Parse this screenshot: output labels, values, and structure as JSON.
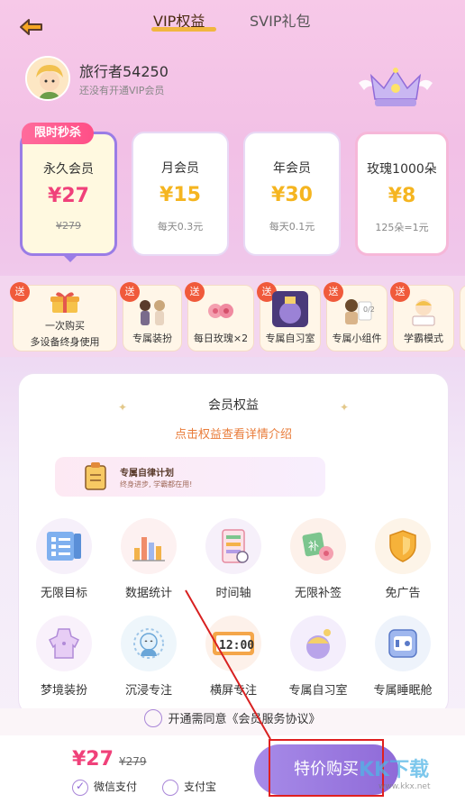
{
  "tabs": [
    {
      "label": "VIP权益"
    },
    {
      "label": "SVIP礼包"
    }
  ],
  "user": {
    "name": "旅行者54250",
    "status": "还没有开通VIP会员"
  },
  "badge": "限时秒杀",
  "plans": [
    {
      "name": "永久会员",
      "price": "¥27",
      "sub": "¥279"
    },
    {
      "name": "月会员",
      "price": "¥15",
      "sub": "每天0.3元"
    },
    {
      "name": "年会员",
      "price": "¥30",
      "sub": "每天0.1元"
    },
    {
      "name": "玫瑰1000朵",
      "price": "¥8",
      "sub": "125朵=1元"
    }
  ],
  "perks": {
    "send": "送",
    "items": [
      {
        "label": "一次购买\n多设备终身使用",
        "label1": "一次购买",
        "label2": "多设备终身使用"
      },
      {
        "label": "专属装扮"
      },
      {
        "label": "每日玫瑰×2"
      },
      {
        "label": "专属自习室"
      },
      {
        "label": "专属小组件",
        "counter": "0/2"
      },
      {
        "label": "学霸模式"
      }
    ]
  },
  "benefits": {
    "title": "会员权益",
    "subtitle": "点击权益查看详情介绍",
    "banner_title": "专属自律计划",
    "banner_sub": "终身进步, 学霸都在用!",
    "items": [
      {
        "label": "无限目标",
        "icon": "target-list-icon"
      },
      {
        "label": "数据统计",
        "icon": "bar-chart-icon"
      },
      {
        "label": "时间轴",
        "icon": "timeline-icon"
      },
      {
        "label": "无限补签",
        "icon": "makeup-checkin-icon"
      },
      {
        "label": "免广告",
        "icon": "shield-icon"
      },
      {
        "label": "梦境装扮",
        "icon": "dress-icon"
      },
      {
        "label": "沉浸专注",
        "icon": "focus-icon"
      },
      {
        "label": "横屏专注",
        "icon": "clock-icon"
      },
      {
        "label": "专属自习室",
        "icon": "study-room-icon"
      },
      {
        "label": "专属睡眠舱",
        "icon": "sleep-pod-icon"
      }
    ],
    "clock_text": "12:00"
  },
  "agreement": "开通需同意《会员服务协议》",
  "footer": {
    "price": "¥27",
    "old_price": "¥279",
    "pay_wechat": "微信支付",
    "pay_alipay": "支付宝",
    "buy_label": "特价购买"
  },
  "watermark": {
    "text": "KK下载",
    "url": "www.kkx.net"
  },
  "colors": {
    "accent": "#9a7de6",
    "price": "#f0417a",
    "gold": "#f5b520"
  }
}
